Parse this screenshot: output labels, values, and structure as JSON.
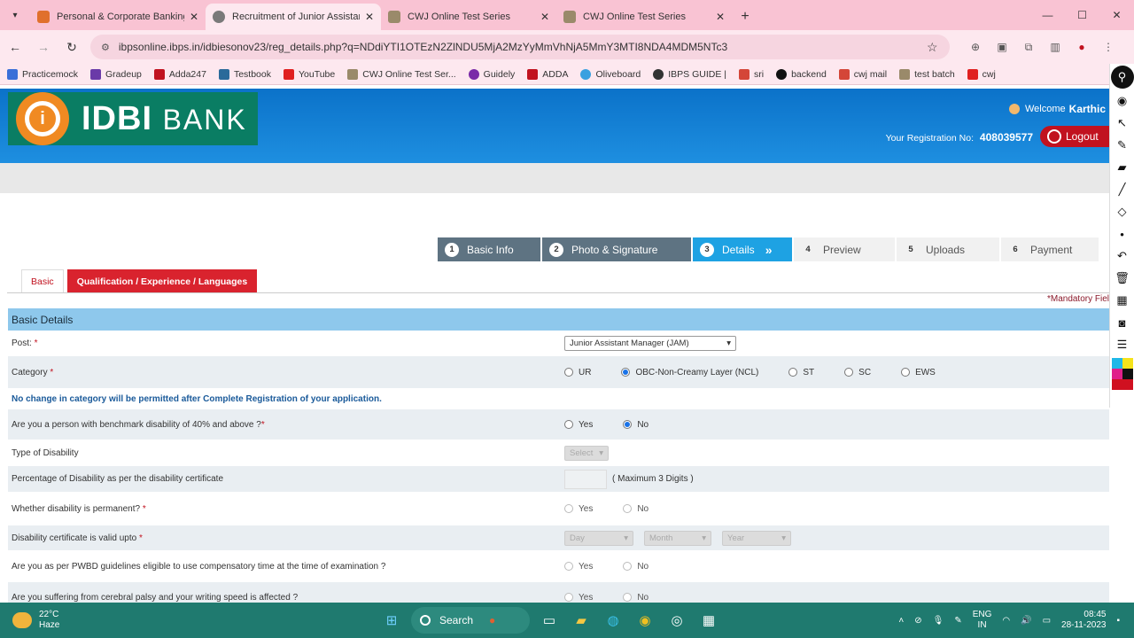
{
  "browser": {
    "tabs": [
      {
        "title": "Personal & Corporate Banking",
        "color": "#e0702c"
      },
      {
        "title": "Recruitment of Junior Assistant",
        "color": "#7a7a7a"
      },
      {
        "title": "CWJ Online Test Series",
        "color": "#9a8a6a"
      },
      {
        "title": "CWJ Online Test Series",
        "color": "#9a8a6a"
      }
    ],
    "url": "ibpsonline.ibps.in/idbiesonov23/reg_details.php?q=NDdiYTI1OTEzN2ZlNDU5MjA2MzYyMmVhNjA5MmY3MTI8NDA4MDM5NTc3",
    "bookmarks": [
      "Practicemock",
      "Gradeup",
      "Adda247",
      "Testbook",
      "YouTube",
      "CWJ Online Test Ser...",
      "Guidely",
      "ADDA",
      "Oliveboard",
      "IBPS GUIDE |",
      "sri",
      "backend",
      "cwj mail",
      "test batch",
      "cwj"
    ]
  },
  "header": {
    "logo_text": "IDBI",
    "logo_bank": "BANK",
    "welcome_label": "Welcome",
    "welcome_name": "Karthic",
    "reg_label": "Your Registration No:",
    "reg_no": "408039577",
    "logout": "Logout"
  },
  "steps": [
    {
      "num": "1",
      "label": "Basic Info"
    },
    {
      "num": "2",
      "label": "Photo & Signature"
    },
    {
      "num": "3",
      "label": "Details"
    },
    {
      "num": "4",
      "label": "Preview"
    },
    {
      "num": "5",
      "label": "Uploads"
    },
    {
      "num": "6",
      "label": "Payment"
    }
  ],
  "subtabs": {
    "basic": "Basic",
    "qualification": "Qualification / Experience / Languages"
  },
  "mandatory": "*Mandatory Fiel",
  "form": {
    "section_title": "Basic Details",
    "post_label": "Post:",
    "post_value": "Junior Assistant Manager (JAM)",
    "category_label": "Category",
    "category_options": [
      "UR",
      "OBC-Non-Creamy Layer (NCL)",
      "ST",
      "SC",
      "EWS"
    ],
    "category_note": "No change in category will be permitted after Complete Registration of your application.",
    "disability_label": "Are you a person with benchmark disability of 40% and above ?",
    "yes": "Yes",
    "no": "No",
    "type_label": "Type of Disability",
    "select": "Select",
    "pct_label": "Percentage of Disability as per the disability certificate",
    "pct_hint": "( Maximum 3 Digits )",
    "permanent_label": "Whether disability is permanent?",
    "valid_label": "Disability certificate is valid upto",
    "day": "Day",
    "month": "Month",
    "year": "Year",
    "pwbd_label": "Are you as per PWBD guidelines eligible to use compensatory time at the time of examination ?",
    "last_label": "Are you suffering from cerebral palsy and your writing speed is affected ?"
  },
  "taskbar": {
    "temp": "22°C",
    "weather": "Haze",
    "search": "Search",
    "lang1": "ENG",
    "lang2": "IN",
    "time": "08:45",
    "date": "28-11-2023"
  }
}
